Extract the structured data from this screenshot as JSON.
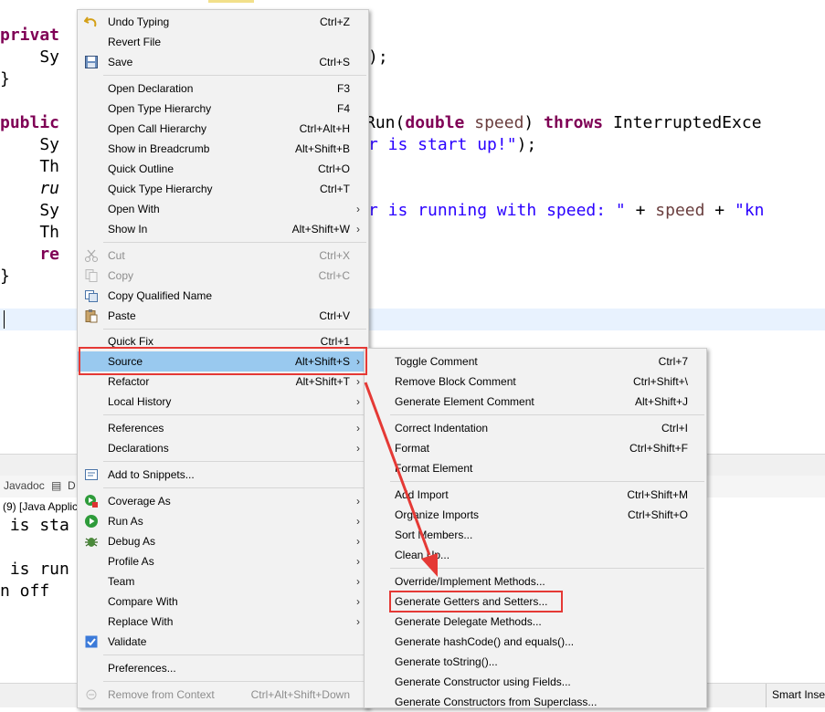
{
  "editor": {
    "lines": {
      "l1_kw": "privat",
      "l2_a": "    Sy",
      "l2_b": ");",
      "l3": "}",
      "l5_kw": "public",
      "l5_method": "Run(",
      "l5_double": "double",
      "l5_param": " speed",
      "l5_paren": ") ",
      "l5_throws": "throws",
      "l5_exc": " InterruptedExce",
      "l6_a": "    Sy",
      "l6_str": "r is start up!\"",
      "l6_end": ");",
      "l7": "    Th",
      "l8": "    ru",
      "l9_a": "    Sy",
      "l9_str": "r is running with speed: \"",
      "l9_plus": " + ",
      "l9_speed": "speed",
      "l9_plus2": " + ",
      "l9_kn": "\"kn",
      "l10": "    Th",
      "l11_kw": "    re",
      "l12": "}"
    }
  },
  "views": {
    "tabs": [
      "Javadoc",
      "D"
    ],
    "console_header": "(9) [Java Applic",
    "console_lines": [
      " is sta",
      " is run",
      "n off"
    ]
  },
  "status": {
    "insert_mode": "Smart Inser"
  },
  "context_menu": {
    "items": [
      {
        "label": "Undo Typing",
        "accel": "Ctrl+Z",
        "icon": "undo-icon"
      },
      {
        "label": "Revert File",
        "accel": ""
      },
      {
        "label": "Save",
        "accel": "Ctrl+S",
        "icon": "save-icon"
      },
      {
        "label": "Open Declaration",
        "accel": "F3"
      },
      {
        "label": "Open Type Hierarchy",
        "accel": "F4"
      },
      {
        "label": "Open Call Hierarchy",
        "accel": "Ctrl+Alt+H"
      },
      {
        "label": "Show in Breadcrumb",
        "accel": "Alt+Shift+B"
      },
      {
        "label": "Quick Outline",
        "accel": "Ctrl+O"
      },
      {
        "label": "Quick Type Hierarchy",
        "accel": "Ctrl+T"
      },
      {
        "label": "Open With",
        "accel": ""
      },
      {
        "label": "Show In",
        "accel": "Alt+Shift+W"
      },
      {
        "label": "Cut",
        "accel": "Ctrl+X",
        "icon": "scissors-icon"
      },
      {
        "label": "Copy",
        "accel": "Ctrl+C",
        "icon": "copy-icon"
      },
      {
        "label": "Copy Qualified Name",
        "accel": "",
        "icon": "copy-qualified-icon"
      },
      {
        "label": "Paste",
        "accel": "Ctrl+V",
        "icon": "paste-icon"
      },
      {
        "label": "Quick Fix",
        "accel": "Ctrl+1"
      },
      {
        "label": "Source",
        "accel": "Alt+Shift+S"
      },
      {
        "label": "Refactor",
        "accel": "Alt+Shift+T"
      },
      {
        "label": "Local History",
        "accel": ""
      },
      {
        "label": "References",
        "accel": ""
      },
      {
        "label": "Declarations",
        "accel": ""
      },
      {
        "label": "Add to Snippets...",
        "accel": "",
        "icon": "snippet-icon"
      },
      {
        "label": "Coverage As",
        "accel": "",
        "icon": "coverage-icon"
      },
      {
        "label": "Run As",
        "accel": "",
        "icon": "run-icon"
      },
      {
        "label": "Debug As",
        "accel": "",
        "icon": "debug-icon"
      },
      {
        "label": "Profile As",
        "accel": ""
      },
      {
        "label": "Team",
        "accel": ""
      },
      {
        "label": "Compare With",
        "accel": ""
      },
      {
        "label": "Replace With",
        "accel": ""
      },
      {
        "label": "Validate",
        "accel": "",
        "icon": "checkbox-icon"
      },
      {
        "label": "Preferences...",
        "accel": ""
      },
      {
        "label": "Remove from Context",
        "accel": "Ctrl+Alt+Shift+Down"
      }
    ]
  },
  "source_submenu": {
    "items": [
      {
        "label": "Toggle Comment",
        "accel": "Ctrl+7"
      },
      {
        "label": "Remove Block Comment",
        "accel": "Ctrl+Shift+\\"
      },
      {
        "label": "Generate Element Comment",
        "accel": "Alt+Shift+J"
      },
      {
        "label": "Correct Indentation",
        "accel": "Ctrl+I"
      },
      {
        "label": "Format",
        "accel": "Ctrl+Shift+F"
      },
      {
        "label": "Format Element",
        "accel": ""
      },
      {
        "label": "Add Import",
        "accel": "Ctrl+Shift+M"
      },
      {
        "label": "Organize Imports",
        "accel": "Ctrl+Shift+O"
      },
      {
        "label": "Sort Members...",
        "accel": ""
      },
      {
        "label": "Clean Up...",
        "accel": ""
      },
      {
        "label": "Override/Implement Methods...",
        "accel": ""
      },
      {
        "label": "Generate Getters and Setters...",
        "accel": ""
      },
      {
        "label": "Generate Delegate Methods...",
        "accel": ""
      },
      {
        "label": "Generate hashCode() and equals()...",
        "accel": ""
      },
      {
        "label": "Generate toString()...",
        "accel": ""
      },
      {
        "label": "Generate Constructor using Fields...",
        "accel": ""
      },
      {
        "label": "Generate Constructors from Superclass...",
        "accel": ""
      }
    ]
  },
  "colors": {
    "highlight_annotation": "#e53935",
    "menu_selection": "#99c9ef",
    "keyword": "#7f0055",
    "string": "#2a00ff"
  }
}
